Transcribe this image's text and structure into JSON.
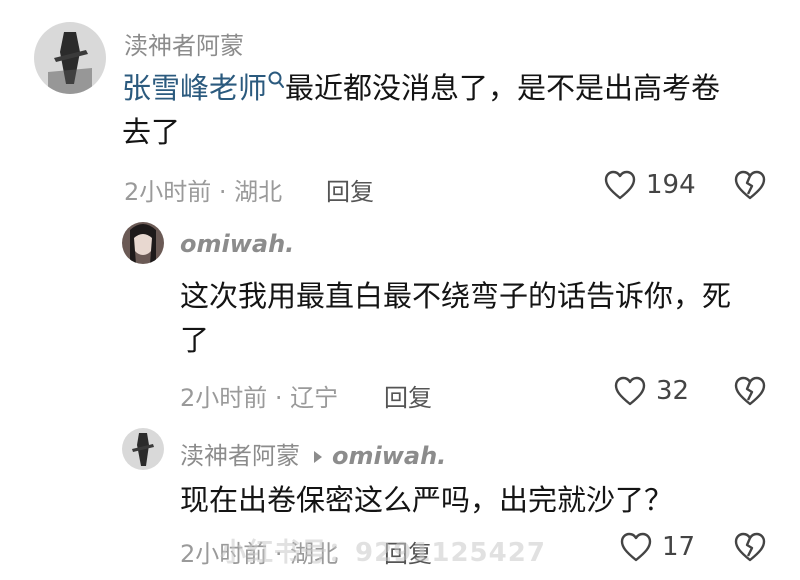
{
  "comment1": {
    "username": "渎神者阿蒙",
    "mention": "张雪峰老师",
    "text_line1": "最近都没消息了，是不是出高考卷",
    "text_line2": "去了",
    "time_location": "2小时前 · 湖北",
    "reply_label": "回复",
    "likes": "194"
  },
  "reply1": {
    "username": "omiwah.",
    "text_line1": "这次我用最直白最不绕弯子的话告诉你，死",
    "text_line2": "了",
    "time_location": "2小时前 · 辽宁",
    "reply_label": "回复",
    "likes": "32"
  },
  "reply2": {
    "username": "渎神者阿蒙",
    "reply_to": "omiwah.",
    "text": "现在出卷保密这么严吗，出完就沙了？",
    "time_location": "2小时前 · 湖北",
    "reply_label": "回复",
    "likes": "17"
  },
  "watermark": "小红书号：9291125427",
  "icons": {
    "like": "heart-outline-icon",
    "dislike": "broken-heart-icon",
    "search": "search-icon"
  }
}
